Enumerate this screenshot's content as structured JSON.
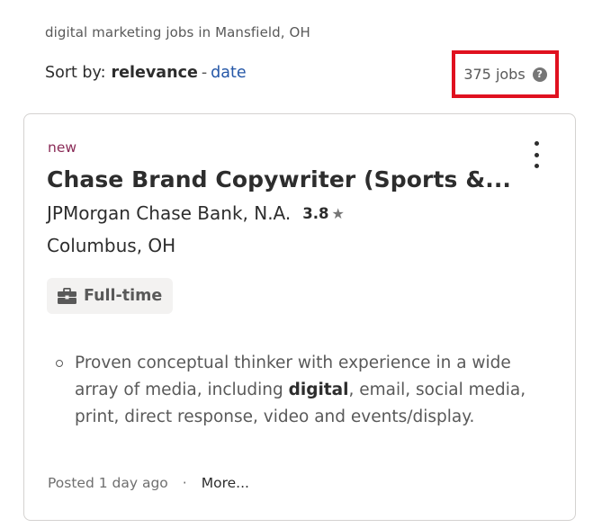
{
  "search": {
    "context": "digital marketing jobs in Mansfield, OH"
  },
  "sort": {
    "label": "Sort by:",
    "active": "relevance",
    "separator": "-",
    "alternative": "date"
  },
  "results": {
    "count_text": "375 jobs",
    "help_glyph": "?"
  },
  "job": {
    "badge": "new",
    "title": "Chase Brand Copywriter (Sports &...",
    "company": "JPMorgan Chase Bank, N.A.",
    "rating": "3.8",
    "star_glyph": "★",
    "location": "Columbus, OH",
    "job_type": "Full-time",
    "snippet": {
      "before": "Proven conceptual thinker with experience in a wide array of media, including ",
      "highlight": "digital",
      "after": ", email, social media, print, direct response, video and events/display."
    },
    "posted": "Posted 1 day ago",
    "separator": "·",
    "more_link": "More..."
  },
  "colors": {
    "highlight_box": "#e0111f",
    "link": "#2557a7",
    "new_badge": "#8a2b57",
    "tag_background": "#f3f2f1"
  },
  "icons": {
    "help": "help-circle-icon",
    "kebab": "kebab-menu-icon",
    "star": "star-icon",
    "job_type": "briefcase-icon"
  }
}
